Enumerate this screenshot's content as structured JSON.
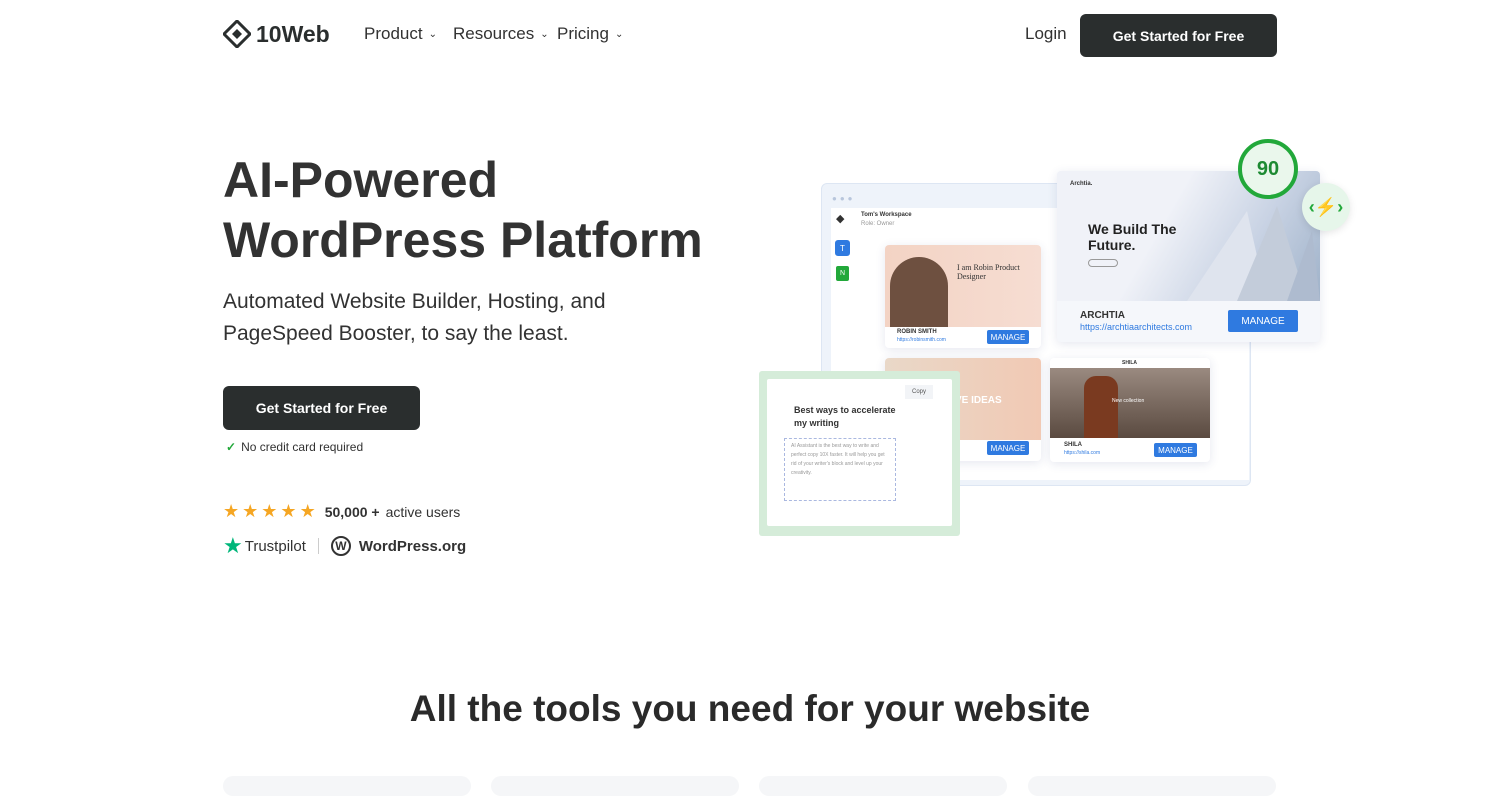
{
  "nav": {
    "logo": "10Web",
    "items": [
      {
        "label": "Product"
      },
      {
        "label": "Resources"
      },
      {
        "label": "Pricing"
      }
    ],
    "login": "Login",
    "cta": "Get Started for Free"
  },
  "hero": {
    "title_line1": "AI-Powered",
    "title_line2": "WordPress Platform",
    "subtitle": "Automated Website Builder, Hosting, and PageSpeed Booster, to say the least.",
    "cta": "Get Started for Free",
    "note": "No credit card required",
    "rating_stars": 5,
    "users_count": "50,000 +",
    "users_label": "active users",
    "trustpilot": "Trustpilot",
    "wordpress": "WordPress.org"
  },
  "mockup": {
    "workspace": "Tom's Workspace",
    "role": "Role: Owner",
    "avatar_t": "T",
    "avatar_n": "N",
    "pagespeed_score": "90",
    "sites": [
      {
        "name": "ROBIN SMITH",
        "url": "https://robinsmith.com",
        "headline": "I am Robin Product Designer",
        "manage": "MANAGE"
      },
      {
        "name": "ARCHTIA",
        "url": "https://archtiaarchitects.com",
        "headline": "We Build The Future.",
        "brand": "Archtia.",
        "manage": "MANAGE"
      },
      {
        "name": "",
        "url": "",
        "headline": "VE IDEAS",
        "manage": "MANAGE"
      },
      {
        "name": "SHILA",
        "url": "https://shila.com",
        "headline": "New collection",
        "brand": "SHILA",
        "manage": "MANAGE"
      }
    ],
    "ai": {
      "copy": "Copy",
      "title": "Best ways to accelerate my writing",
      "body": "AI Assistant is the best way to write and perfect copy 10X faster. It will help you get rid of your writer's block and level up your creativity."
    }
  },
  "tools": {
    "title": "All the tools you need for your website"
  },
  "colors": {
    "dark": "#2a2e2e",
    "accent_blue": "#2f7ae0",
    "green": "#22a83a",
    "star": "#f5a623"
  }
}
